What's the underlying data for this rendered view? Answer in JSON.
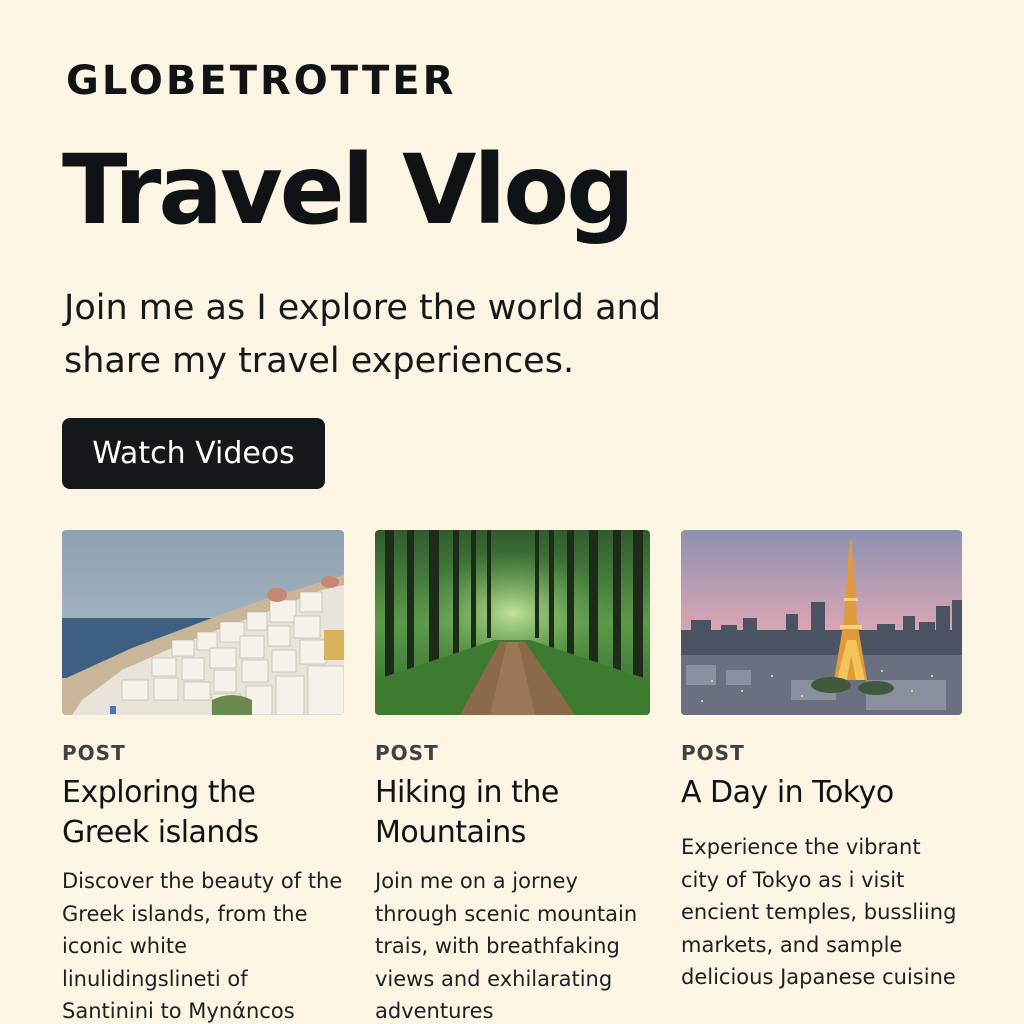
{
  "brand": "GLOBETROTTER",
  "hero": {
    "title": "Travel Vlog",
    "subtitle": "Join me as I explore the world and share my travel experiences.",
    "cta_label": "Watch Videos"
  },
  "posts": [
    {
      "kicker": "POST",
      "title": "Exploring the Greek islands",
      "body": "Discover the beauty of the Greek islands, from the iconic white linulidingslineti of Santinini to Mynάncos",
      "image": "greek-island-village-photo"
    },
    {
      "kicker": "POST",
      "title": "Hiking in the Mountains",
      "body": "Join me on a jorney through scenic mountain trais, with breathfaking views and exhilarating adventures",
      "image": "forest-trail-photo"
    },
    {
      "kicker": "POST",
      "title": "A Day in Tokyo",
      "body": "Experience the vibrant city of Tokyo as i visit encient temples, bussliing markets, and sample delicious Japanese cuisine",
      "image": "tokyo-skyline-tower-photo"
    }
  ],
  "colors": {
    "background": "#fdf5e4",
    "text": "#111417",
    "button": "#14181b",
    "button_text": "#ffffff"
  }
}
